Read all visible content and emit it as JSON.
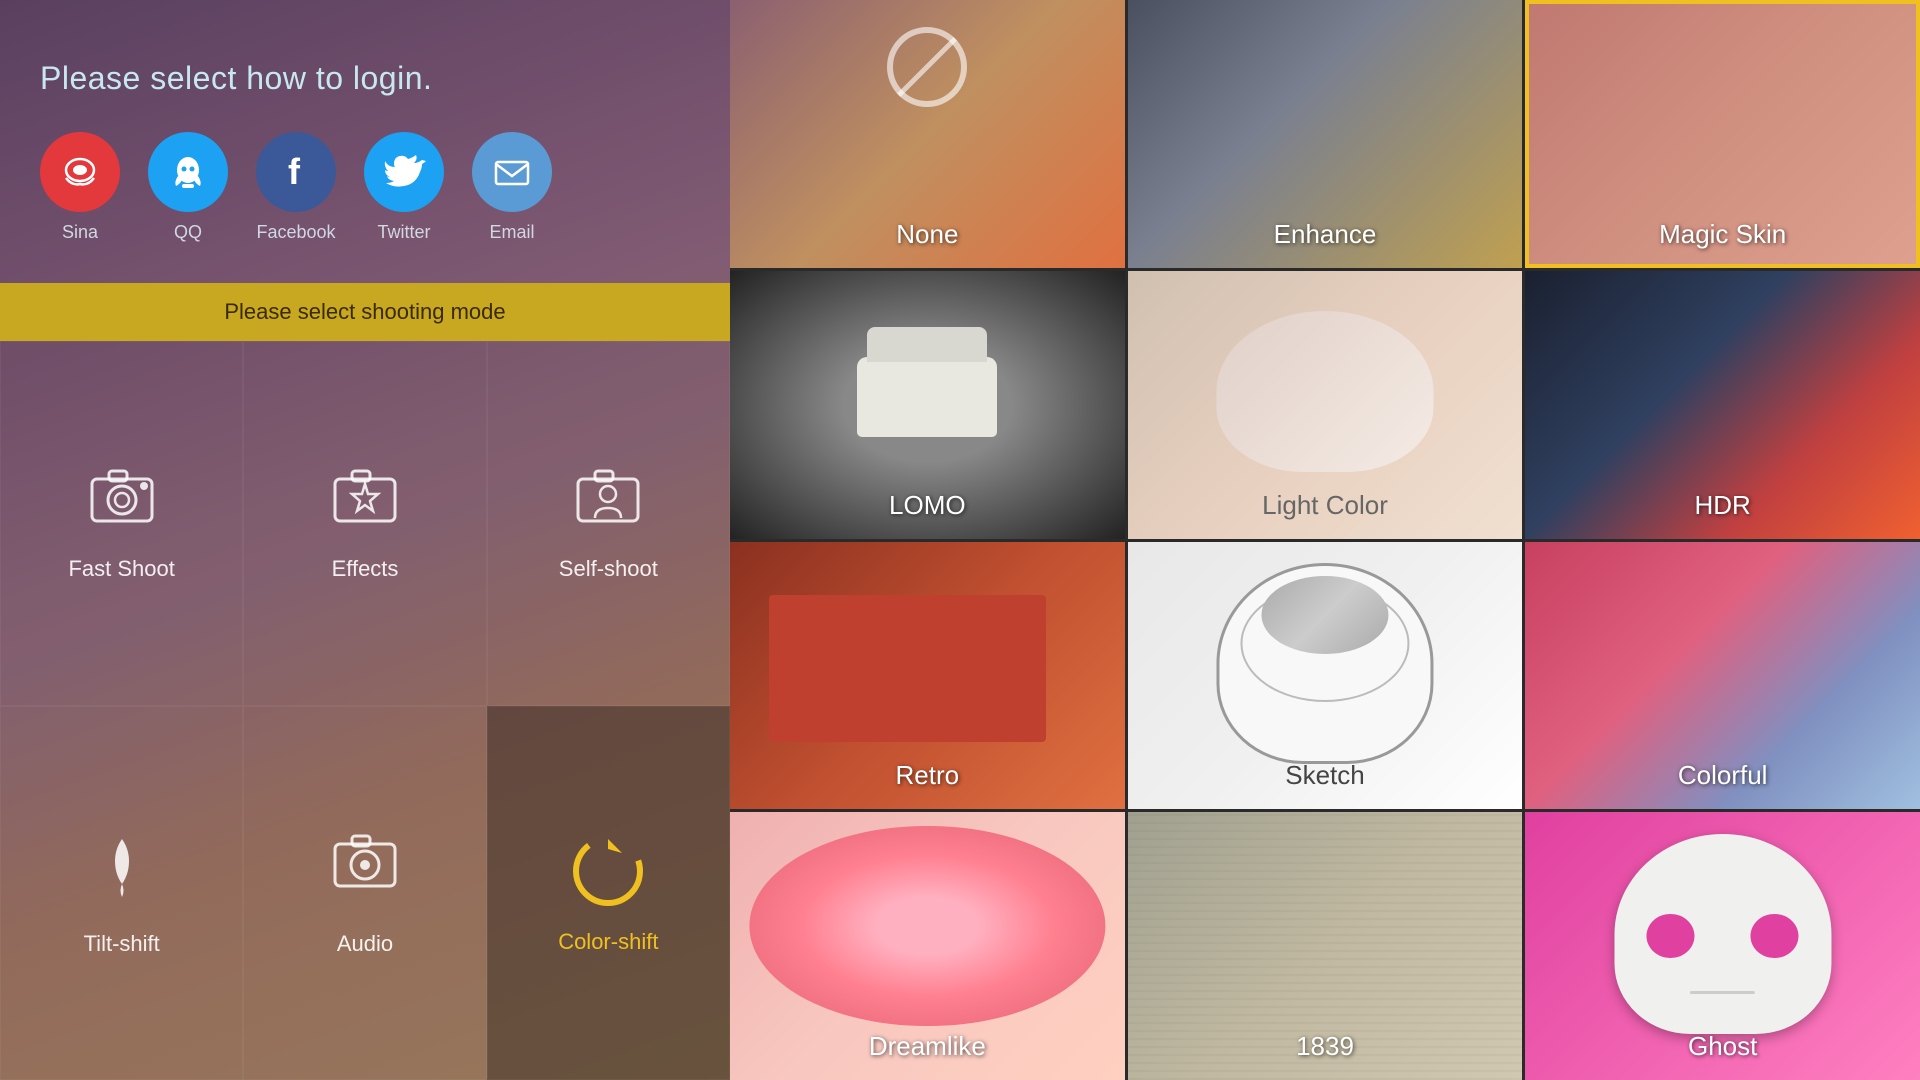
{
  "left": {
    "login_title": "Please select how to login.",
    "social_items": [
      {
        "id": "sina",
        "label": "Sina",
        "class": "sina-circle",
        "icon": "微"
      },
      {
        "id": "qq",
        "label": "QQ",
        "class": "qq-circle",
        "icon": "🐧"
      },
      {
        "id": "facebook",
        "label": "Facebook",
        "class": "facebook-circle",
        "icon": "f"
      },
      {
        "id": "twitter",
        "label": "Twitter",
        "class": "twitter-circle",
        "icon": "🐦"
      },
      {
        "id": "email",
        "label": "Email",
        "class": "email-circle",
        "icon": "✉"
      }
    ],
    "shooting_banner": "Please select shooting mode",
    "shoot_items": [
      {
        "id": "fast-shoot",
        "label": "Fast Shoot",
        "icon": "📷",
        "active": false
      },
      {
        "id": "effects",
        "label": "Effects",
        "icon": "⭐",
        "active": false
      },
      {
        "id": "self-shoot",
        "label": "Self-shoot",
        "icon": "👤",
        "active": false
      },
      {
        "id": "tilt-shift",
        "label": "Tilt-shift",
        "icon": "💧",
        "active": false
      },
      {
        "id": "audio",
        "label": "Audio",
        "icon": "🎵",
        "active": false
      },
      {
        "id": "color-shift",
        "label": "Color-shift",
        "icon": "colorshift",
        "active": true
      }
    ]
  },
  "right": {
    "filters": [
      {
        "id": "none",
        "label": "None",
        "bg": "bg-none",
        "selected": false
      },
      {
        "id": "enhance",
        "label": "Enhance",
        "bg": "bg-enhance",
        "selected": false
      },
      {
        "id": "magic-skin",
        "label": "Magic Skin",
        "bg": "bg-magicskin",
        "selected": true
      },
      {
        "id": "lomo",
        "label": "LOMO",
        "bg": "bg-lomo",
        "selected": false
      },
      {
        "id": "light-color",
        "label": "Light Color",
        "bg": "bg-lightcolor",
        "selected": false
      },
      {
        "id": "hdr",
        "label": "HDR",
        "bg": "bg-hdr",
        "selected": false
      },
      {
        "id": "retro",
        "label": "Retro",
        "bg": "bg-retro",
        "selected": false
      },
      {
        "id": "sketch",
        "label": "Sketch",
        "bg": "bg-sketch",
        "selected": false
      },
      {
        "id": "colorful",
        "label": "Colorful",
        "bg": "bg-colorful",
        "selected": false
      },
      {
        "id": "dreamlike",
        "label": "Dreamlike",
        "bg": "bg-dreamlike",
        "selected": false
      },
      {
        "id": "1839",
        "label": "1839",
        "bg": "bg-1839",
        "selected": false
      },
      {
        "id": "ghost",
        "label": "Ghost",
        "bg": "bg-ghost",
        "selected": false
      }
    ]
  }
}
